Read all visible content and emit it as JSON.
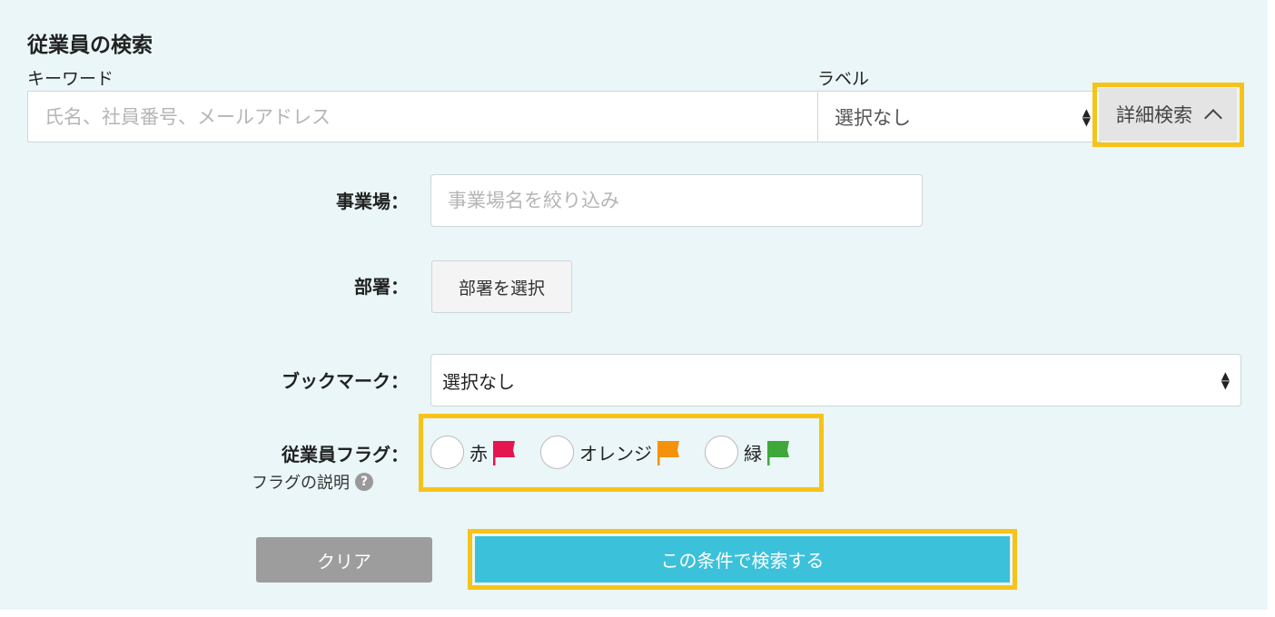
{
  "search": {
    "title": "従業員の検索",
    "keyword_label": "キーワード",
    "keyword_placeholder": "氏名、社員番号、メールアドレス",
    "label_label": "ラベル",
    "label_value": "選択なし",
    "advanced_label": "詳細検索"
  },
  "filters": {
    "office_label": "事業場：",
    "office_placeholder": "事業場名を絞り込み",
    "dept_label": "部署：",
    "dept_button": "部署を選択",
    "bookmark_label": "ブックマーク：",
    "bookmark_value": "選択なし",
    "flag_label": "従業員フラグ：",
    "flag_help": "フラグの説明",
    "help_icon_text": "?",
    "flags": [
      {
        "label": "赤",
        "color": "#e5154f"
      },
      {
        "label": "オレンジ",
        "color": "#f5910b"
      },
      {
        "label": "緑",
        "color": "#3ea83a"
      }
    ]
  },
  "actions": {
    "clear": "クリア",
    "search": "この条件で検索する"
  },
  "colors": {
    "highlight": "#f7c318",
    "primary": "#3cc1da",
    "panel_bg": "#eaf6f8"
  }
}
